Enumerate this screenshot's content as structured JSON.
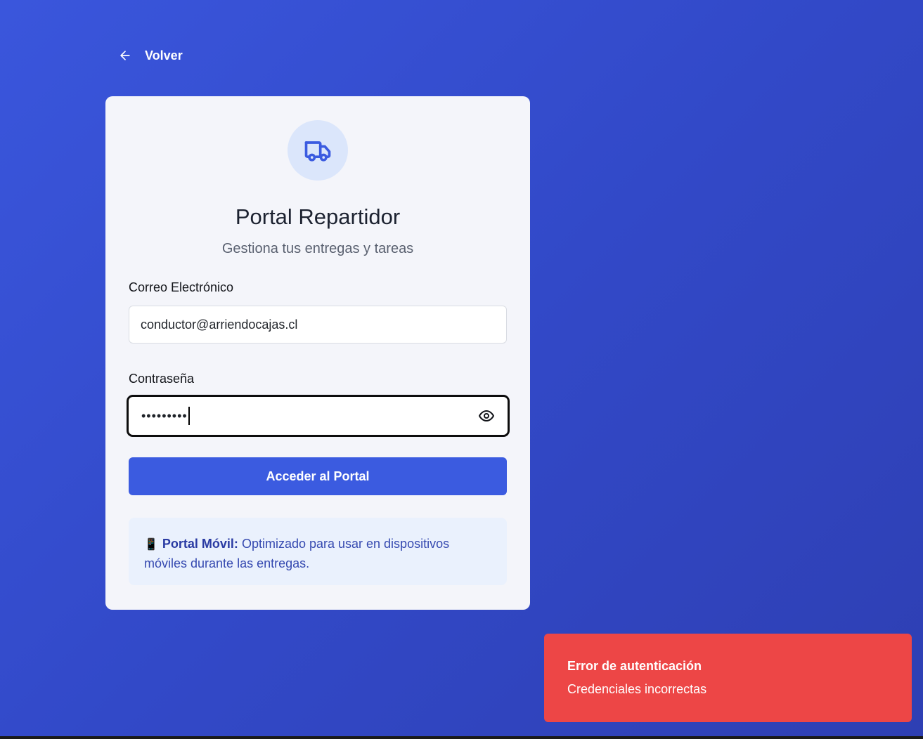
{
  "nav": {
    "back_label": "Volver"
  },
  "card": {
    "title": "Portal Repartidor",
    "subtitle": "Gestiona tus entregas y tareas",
    "email": {
      "label": "Correo Electrónico",
      "value": "conductor@arriendocajas.cl"
    },
    "password": {
      "label": "Contraseña",
      "value_masked": "•••••••••"
    },
    "submit_label": "Acceder al Portal",
    "info": {
      "emoji": "📱",
      "title": "Portal Móvil:",
      "text": " Optimizado para usar en dispositivos móviles durante las entregas."
    }
  },
  "toast": {
    "title": "Error de autenticación",
    "message": "Credenciales incorrectas"
  },
  "colors": {
    "accent": "#3b5be0",
    "error": "#ed4646",
    "background": "#3249c8"
  },
  "icons": {
    "back": "arrow-left-icon",
    "logo": "truck-icon",
    "password_toggle": "eye-icon"
  }
}
